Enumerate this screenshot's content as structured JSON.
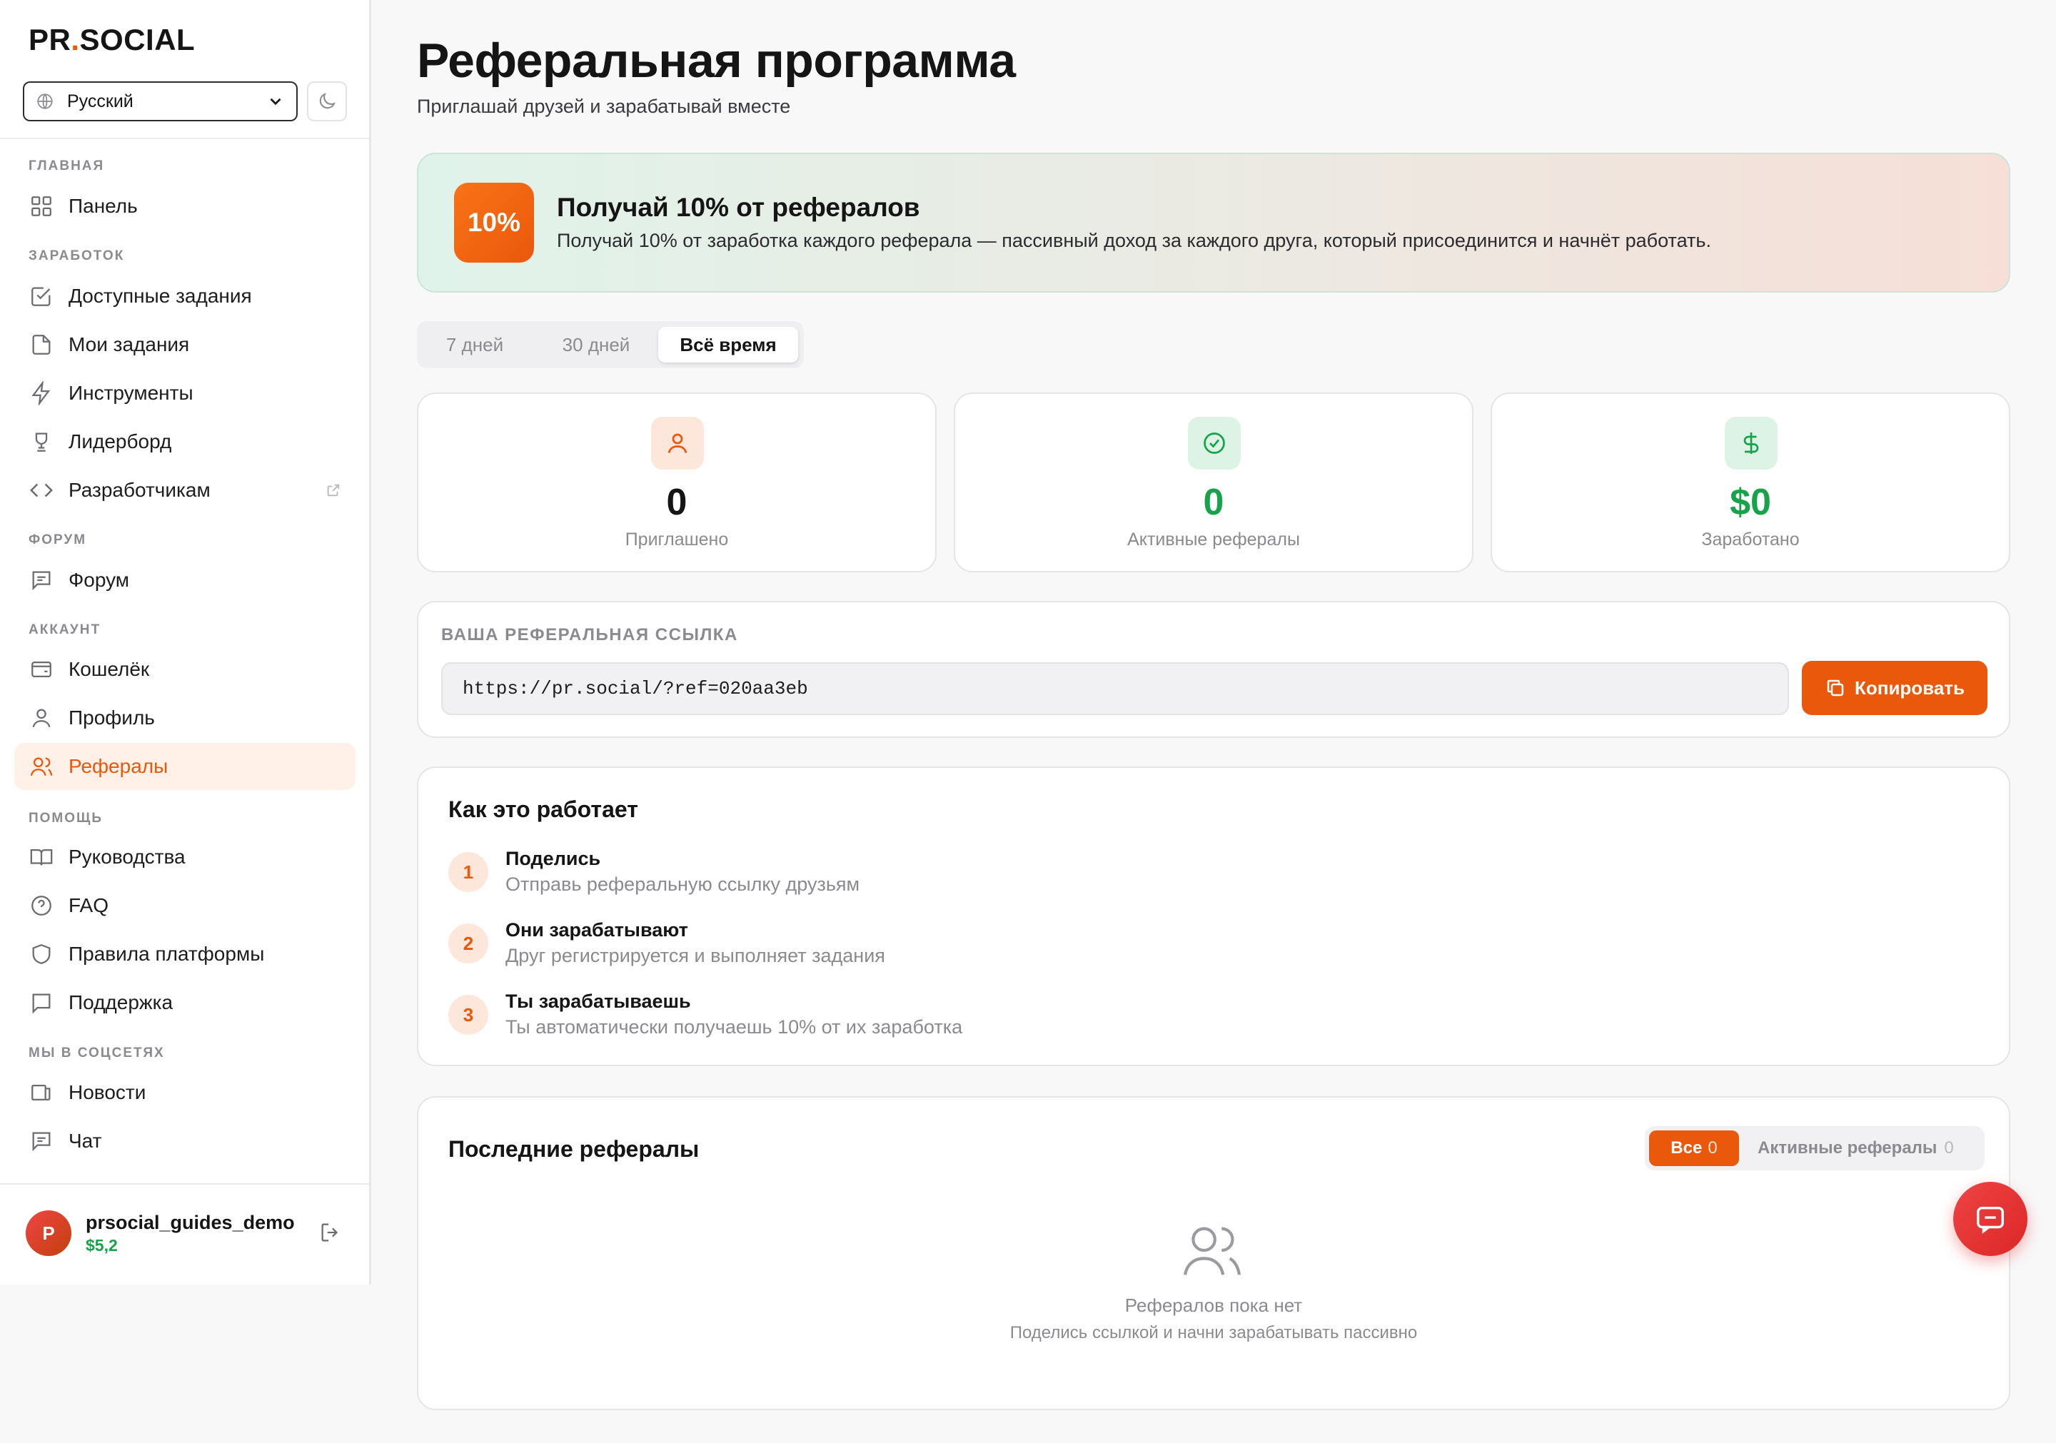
{
  "brand": {
    "part1": "PR",
    "dot": ".",
    "part2": "SOCIAL"
  },
  "language": {
    "selected": "Русский"
  },
  "sidebar": {
    "sections": [
      "ГЛАВНАЯ",
      "ЗАРАБОТОК",
      "ФОРУМ",
      "АККАУНТ",
      "ПОМОЩЬ",
      "МЫ В СОЦСЕТЯХ"
    ],
    "items": [
      {
        "label": "Панель",
        "icon": "dashboard-icon"
      },
      {
        "label": "Доступные задания",
        "icon": "checkbox-icon"
      },
      {
        "label": "Мои задания",
        "icon": "file-icon"
      },
      {
        "label": "Инструменты",
        "icon": "bolt-icon"
      },
      {
        "label": "Лидерборд",
        "icon": "trophy-icon"
      },
      {
        "label": "Разработчикам",
        "icon": "code-icon"
      },
      {
        "label": "Форум",
        "icon": "message-icon"
      },
      {
        "label": "Кошелёк",
        "icon": "wallet-icon"
      },
      {
        "label": "Профиль",
        "icon": "user-icon"
      },
      {
        "label": "Рефералы",
        "icon": "users-icon",
        "active": true
      },
      {
        "label": "Руководства",
        "icon": "book-icon"
      },
      {
        "label": "FAQ",
        "icon": "help-circle-icon"
      },
      {
        "label": "Правила платформы",
        "icon": "shield-icon"
      },
      {
        "label": "Поддержка",
        "icon": "support-icon"
      },
      {
        "label": "Новости",
        "icon": "news-icon"
      },
      {
        "label": "Чат",
        "icon": "chat-icon"
      }
    ]
  },
  "user": {
    "avatar_letter": "P",
    "name": "prsocial_guides_demo",
    "balance": "$5,2"
  },
  "page": {
    "title": "Реферальная программа",
    "subtitle": "Приглашай друзей и зарабатывай вместе"
  },
  "banner": {
    "badge": "10%",
    "title": "Получай 10% от рефералов",
    "text": "Получай 10% от заработка каждого реферала — пассивный доход за каждого друга, который присоединится и начнёт работать."
  },
  "period_tabs": [
    "7 дней",
    "30 дней",
    "Всё время"
  ],
  "period_selected": "Всё время",
  "stats": [
    {
      "value": "0",
      "label": "Приглашено",
      "icon": "user-icon"
    },
    {
      "value": "0",
      "label": "Активные рефералы",
      "icon": "check-circle-icon"
    },
    {
      "value": "$0",
      "label": "Заработано",
      "icon": "dollar-icon"
    }
  ],
  "referral_link": {
    "label": "ВАША РЕФЕРАЛЬНАЯ ССЫЛКА",
    "url": "https://pr.social/?ref=020aa3eb",
    "copy_label": "Копировать"
  },
  "how_it_works": {
    "title": "Как это работает",
    "steps": [
      {
        "num": "1",
        "title": "Поделись",
        "desc": "Отправь реферальную ссылку друзьям"
      },
      {
        "num": "2",
        "title": "Они зарабатывают",
        "desc": "Друг регистрируется и выполняет задания"
      },
      {
        "num": "3",
        "title": "Ты зарабатываешь",
        "desc": "Ты автоматически получаешь 10% от их заработка"
      }
    ]
  },
  "recent": {
    "title": "Последние рефералы",
    "tab_all": "Все",
    "tab_all_count": "0",
    "tab_active": "Активные рефералы",
    "tab_active_count": "0",
    "empty_title": "Рефералов пока нет",
    "empty_desc": "Поделись ссылкой и начни зарабатывать пассивно"
  },
  "colors": {
    "accent": "#ea580c",
    "success": "#16a34a",
    "text": "#151515",
    "muted": "#8a8a8f"
  }
}
